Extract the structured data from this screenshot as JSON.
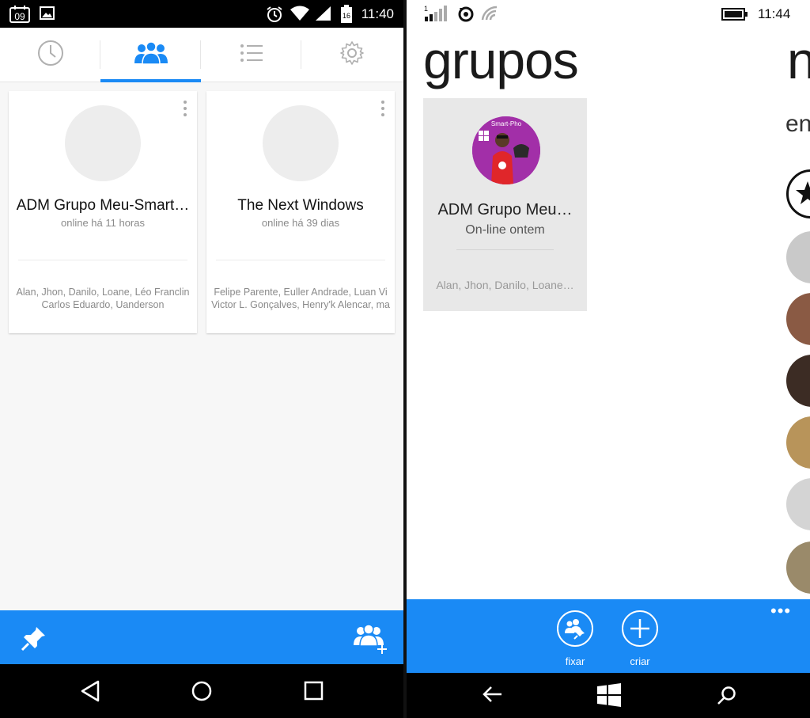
{
  "android": {
    "status_bar": {
      "date_badge": "09",
      "battery_level": "16",
      "time": "11:40"
    },
    "tabs": [
      {
        "name": "recent",
        "icon": "clock-icon",
        "active": false
      },
      {
        "name": "groups",
        "icon": "groups-icon",
        "active": true
      },
      {
        "name": "list",
        "icon": "list-icon",
        "active": false
      },
      {
        "name": "settings",
        "icon": "gear-icon",
        "active": false
      }
    ],
    "groups": [
      {
        "name": "ADM Grupo Meu-Smart…",
        "status": "online há 11 horas",
        "members_line1": "Alan, Jhon, Danilo, Loane, Léo Franclin",
        "members_line2": "Carlos Eduardo, Uanderson"
      },
      {
        "name": "The Next Windows",
        "status": "online há 39 dias",
        "members_line1": "Felipe Parente, Euller Andrade, Luan Vi",
        "members_line2": "Victor L. Gonçalves, Henry'k Alencar, ma"
      }
    ],
    "bottom_bar": {
      "pin_icon": "pin-icon",
      "add_group_icon": "add-group-icon"
    },
    "colors": {
      "accent": "#1a8af5"
    }
  },
  "windows": {
    "status_bar": {
      "time": "11:44"
    },
    "title": "grupos",
    "peek_title": "n",
    "peek_subtitle": "en",
    "group": {
      "name": "ADM Grupo Meu…",
      "status": "On-line ontem",
      "members": "Alan, Jhon, Danilo, Loane…",
      "avatar_text": "Smart-Pho"
    },
    "app_bar": {
      "pin_label": "fixar",
      "create_label": "criar",
      "more": "•••"
    }
  }
}
